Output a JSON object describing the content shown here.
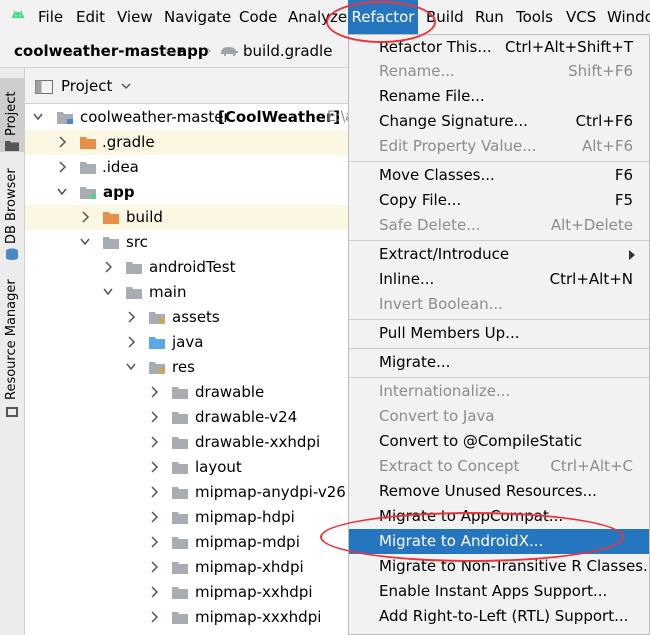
{
  "menubar": {
    "items": [
      {
        "label": "File"
      },
      {
        "label": "Edit"
      },
      {
        "label": "View"
      },
      {
        "label": "Navigate"
      },
      {
        "label": "Code"
      },
      {
        "label": "Analyze"
      },
      {
        "label": "Refactor"
      },
      {
        "label": "Build"
      },
      {
        "label": "Run"
      },
      {
        "label": "Tools"
      },
      {
        "label": "VCS"
      },
      {
        "label": "Windo"
      }
    ]
  },
  "breadcrumb": {
    "project": "coolweather-master",
    "module": "app",
    "file": "build.gradle"
  },
  "toolstrip": {
    "tabs": [
      {
        "label": "Project"
      },
      {
        "label": "DB Browser"
      },
      {
        "label": "Resource Manager"
      }
    ]
  },
  "project_panel": {
    "title": "Project",
    "root_label": "coolweather-master",
    "root_bold": "[CoolWeather]",
    "root_path": "E:\\a",
    "nodes": [
      {
        "label": ".gradle"
      },
      {
        "label": ".idea"
      },
      {
        "label": "app"
      },
      {
        "label": "build"
      },
      {
        "label": "src"
      },
      {
        "label": "androidTest"
      },
      {
        "label": "main"
      },
      {
        "label": "assets"
      },
      {
        "label": "java"
      },
      {
        "label": "res"
      },
      {
        "label": "drawable"
      },
      {
        "label": "drawable-v24"
      },
      {
        "label": "drawable-xxhdpi"
      },
      {
        "label": "layout"
      },
      {
        "label": "mipmap-anydpi-v26"
      },
      {
        "label": "mipmap-hdpi"
      },
      {
        "label": "mipmap-mdpi"
      },
      {
        "label": "mipmap-xhdpi"
      },
      {
        "label": "mipmap-xxhdpi"
      },
      {
        "label": "mipmap-xxxhdpi"
      }
    ]
  },
  "refactor_menu": {
    "items": [
      {
        "label": "Refactor This...",
        "shortcut": "Ctrl+Alt+Shift+T"
      },
      {
        "label": "Rename...",
        "shortcut": "Shift+F6"
      },
      {
        "label": "Rename File..."
      },
      {
        "label": "Change Signature...",
        "shortcut": "Ctrl+F6"
      },
      {
        "label": "Edit Property Value...",
        "shortcut": "Alt+F6"
      },
      {
        "label": "Move Classes...",
        "shortcut": "F6"
      },
      {
        "label": "Copy File...",
        "shortcut": "F5"
      },
      {
        "label": "Safe Delete...",
        "shortcut": "Alt+Delete"
      },
      {
        "label": "Extract/Introduce"
      },
      {
        "label": "Inline...",
        "shortcut": "Ctrl+Alt+N"
      },
      {
        "label": "Invert Boolean..."
      },
      {
        "label": "Pull Members Up..."
      },
      {
        "label": "Migrate..."
      },
      {
        "label": "Internationalize..."
      },
      {
        "label": "Convert to Java"
      },
      {
        "label": "Convert to @CompileStatic"
      },
      {
        "label": "Extract to Concept",
        "shortcut": "Ctrl+Alt+C"
      },
      {
        "label": "Remove Unused Resources..."
      },
      {
        "label": "Migrate to AppCompat..."
      },
      {
        "label": "Migrate to AndroidX..."
      },
      {
        "label": "Migrate to Non-Transitive R Classes..."
      },
      {
        "label": "Enable Instant Apps Support..."
      },
      {
        "label": "Add Right-to-Left (RTL) Support..."
      }
    ]
  },
  "colors": {
    "menu_highlight": "#2675bf",
    "annotation": "#e8343a",
    "folder": "#a8adb3",
    "excluded_folder": "#e88d4a",
    "source_folder": "#5aa9e6",
    "ide_bg": "#f2f2f2"
  }
}
